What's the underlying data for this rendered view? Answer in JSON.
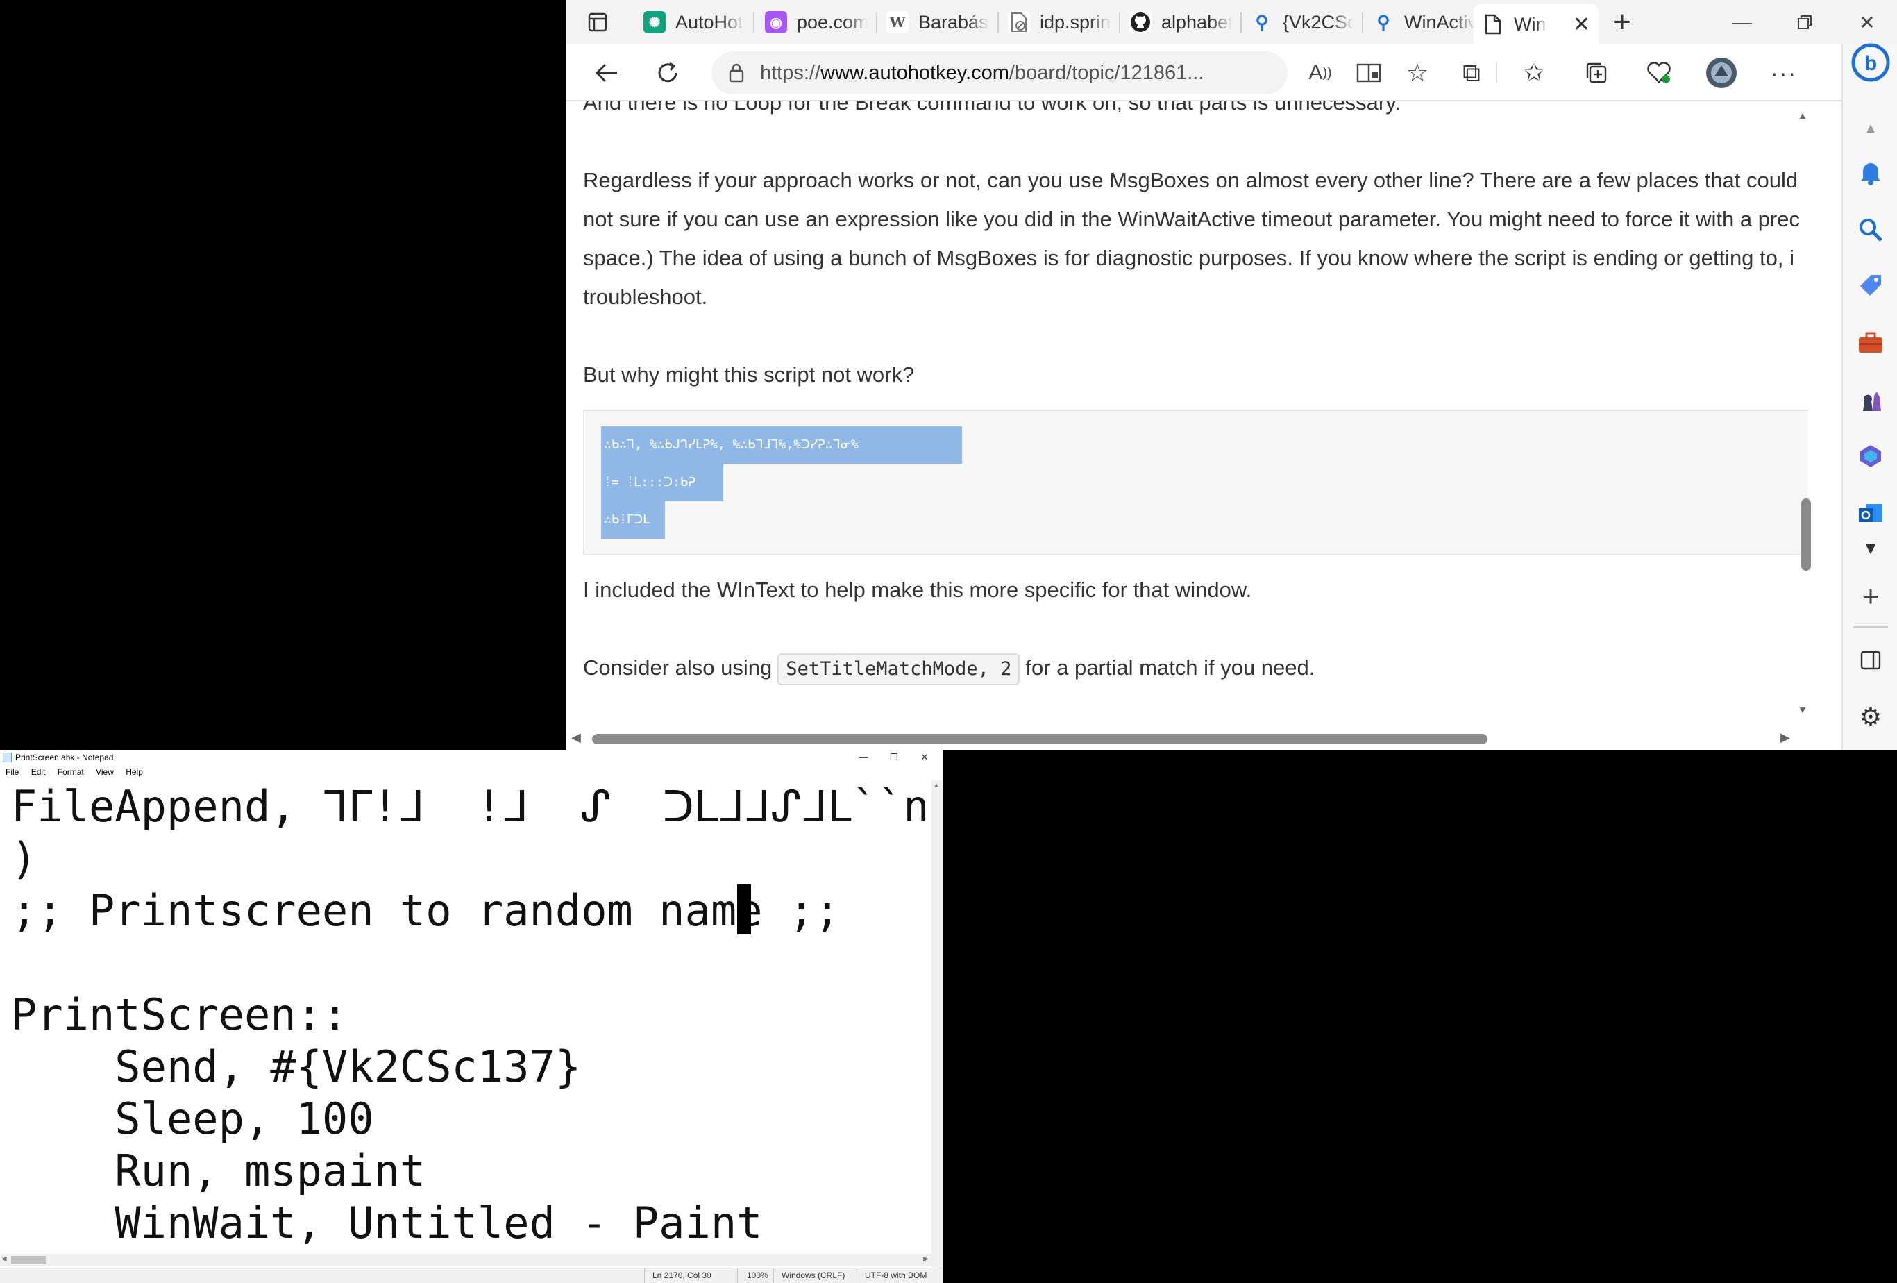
{
  "browser": {
    "tabs": [
      {
        "label": "AutoHot",
        "icon": "chatgpt-icon"
      },
      {
        "label": "poe.com",
        "icon": "poe-icon"
      },
      {
        "label": "Barabási",
        "icon": "wikipedia-icon"
      },
      {
        "label": "idp.sprin",
        "icon": "page-blocked-icon"
      },
      {
        "label": "alphabet",
        "icon": "github-icon"
      },
      {
        "label": "{Vk2CSc",
        "icon": "search-icon"
      },
      {
        "label": "WinActiv",
        "icon": "search-icon"
      },
      {
        "label": "Win",
        "icon": "page-icon"
      }
    ],
    "address_url": "https://www.autohotkey.com/board/topic/121861...",
    "address_prefix": "https://",
    "address_host": "www.autohotkey.com",
    "address_path": "/board/topic/121861...",
    "content": {
      "line_partial": "And there is no Loop for the Break command to work on, so that parts is unnecessary.",
      "para2_l1": "Regardless if your approach works or not, can you use MsgBoxes on almost every other line? There are a few places that could",
      "para2_l2": "not sure if you can use an expression like you did in the WinWaitActive timeout parameter. You might need to force it with a prec",
      "para2_l3": "space.) The idea of using a bunch of MsgBoxes is for diagnostic purposes. If you know where the script is ending or getting to, i",
      "para2_l4": "troubleshoot.",
      "question": "But why might this script not work?",
      "code_lines": [
        "∴ᑲ∴ᒣ, %∴ᑲᒍᒉᓯᒪᕈ%, %∴ᑲᒣᒧᒣ%,%ᑐᓯᕈ∴ᒣᓂ%",
        "⁞= ⁞ᒪ:::ᑐ:ᑲᕈ",
        "∴ᑲ⁞ᒥᑐᒪ"
      ],
      "wintext_note": "I included the WInText to help make this more specific for that window.",
      "consider_pre": "Consider also using",
      "consider_code": "SetTitleMatchMode, 2",
      "consider_post": "for a partial match if you need."
    }
  },
  "notepad": {
    "title": "PrintScreen.ahk - Notepad",
    "menu": [
      "File",
      "Edit",
      "Format",
      "View",
      "Help"
    ],
    "lines": [
      "FileAppend, ᒣᒥ!ᒧ  !ᒧ  ᔑ  ᑐᒪᒧᒧᔑᒧᒪ``n, %L(",
      ")",
      ";; Printscreen to random name ;;",
      "",
      "PrintScreen::",
      "    Send, #{Vk2CSc137}",
      "    Sleep, 100",
      "    Run, mspaint",
      "    WinWait, Untitled - Paint"
    ],
    "status": {
      "position": "Ln 2170, Col 30",
      "zoom": "100%",
      "line_ending": "Windows (CRLF)",
      "encoding": "UTF-8 with BOM"
    }
  },
  "colors": {
    "selection": "#8fb8e6",
    "bing_accent": "#1b6fd8",
    "browser_chrome": "#f3f3f3"
  }
}
